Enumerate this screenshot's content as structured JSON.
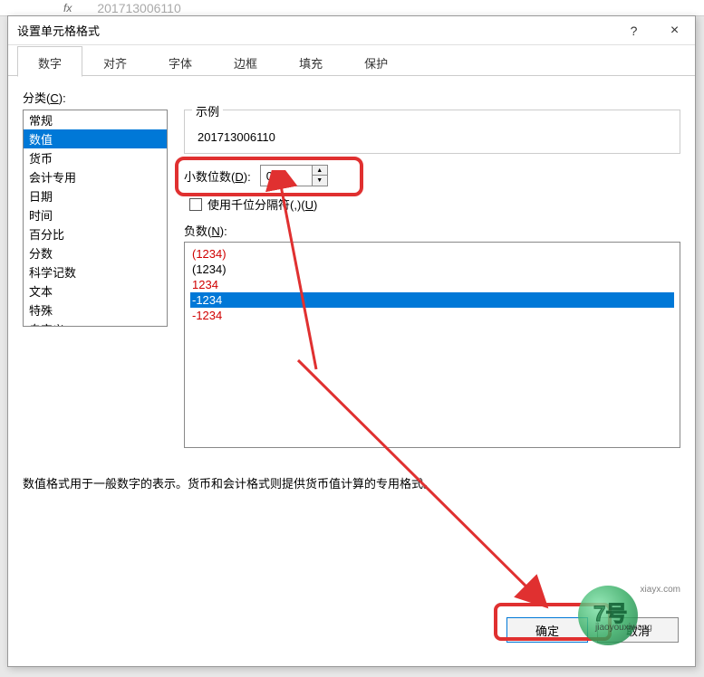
{
  "formula_bar": {
    "fx": "fx",
    "value": "201713006110"
  },
  "dialog": {
    "title": "设置单元格格式",
    "help": "?",
    "close": "×"
  },
  "tabs": {
    "items": [
      {
        "label": "数字"
      },
      {
        "label": "对齐"
      },
      {
        "label": "字体"
      },
      {
        "label": "边框"
      },
      {
        "label": "填充"
      },
      {
        "label": "保护"
      }
    ],
    "active_index": 0
  },
  "category": {
    "label_prefix": "分类(",
    "label_hotkey": "C",
    "label_suffix": "):",
    "items": [
      "常规",
      "数值",
      "货币",
      "会计专用",
      "日期",
      "时间",
      "百分比",
      "分数",
      "科学记数",
      "文本",
      "特殊",
      "自定义"
    ],
    "selected_index": 1
  },
  "sample": {
    "legend": "示例",
    "value": "201713006110"
  },
  "decimals": {
    "label_prefix": "小数位数(",
    "label_hotkey": "D",
    "label_suffix": "):",
    "value": "0"
  },
  "thousands": {
    "label_prefix": "使用千位分隔符(,)(",
    "label_hotkey": "U",
    "label_suffix": ")",
    "checked": false
  },
  "negative": {
    "label_prefix": "负数(",
    "label_hotkey": "N",
    "label_suffix": "):",
    "items": [
      {
        "text": "(1234)",
        "color": "red"
      },
      {
        "text": "(1234)",
        "color": "black"
      },
      {
        "text": "1234",
        "color": "red"
      },
      {
        "text": "-1234",
        "color": "black"
      },
      {
        "text": "-1234",
        "color": "red"
      }
    ],
    "selected_index": 3
  },
  "description": "数值格式用于一般数字的表示。货币和会计格式则提供货币值计算的专用格式。",
  "buttons": {
    "ok": "确定",
    "cancel": "取消"
  },
  "watermark": {
    "brand": "7号",
    "sub": "jiaoyouxiwang",
    "url": "xiayx.com"
  }
}
